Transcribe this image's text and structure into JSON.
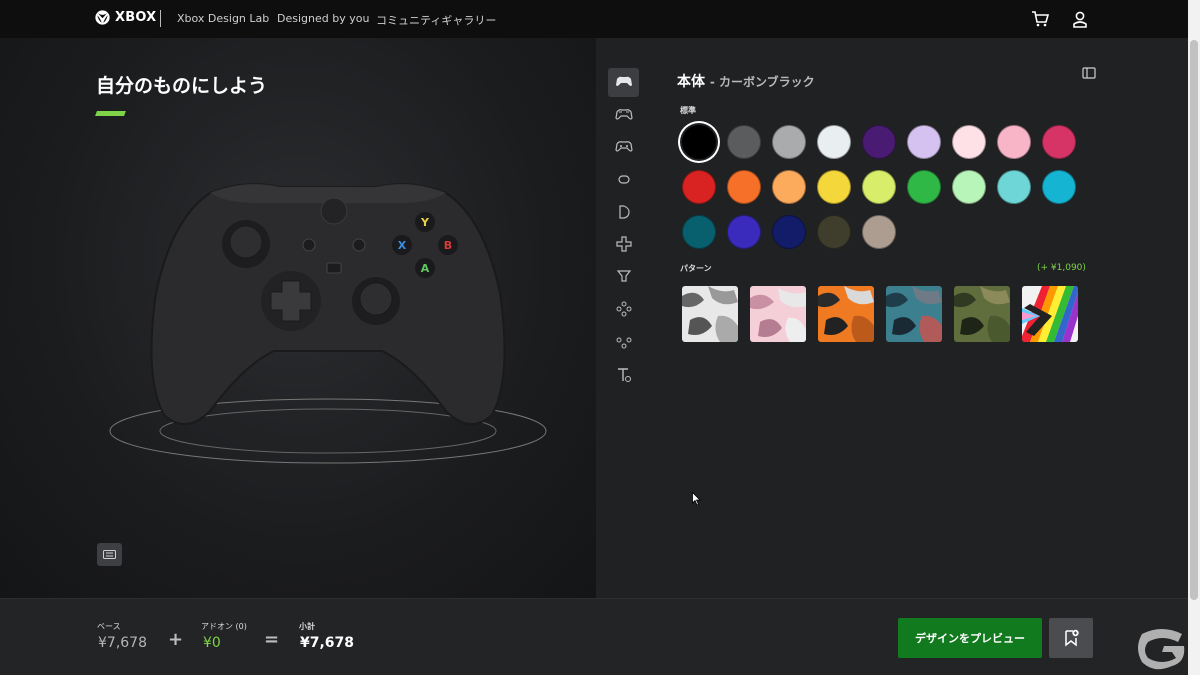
{
  "topbar": {
    "brand": "XBOX",
    "nav": [
      "Xbox Design Lab",
      "Designed by you",
      "コミュニティギャラリー"
    ],
    "icons": [
      "cart-icon",
      "account-icon"
    ]
  },
  "left": {
    "headline": "自分のものにしよう",
    "accent_color": "#7ed348"
  },
  "right": {
    "section_title": "本体",
    "section_subtitle": "- カーボンブラック",
    "solid_label": "標準",
    "pattern_label": "パターン",
    "pattern_price": "(+ ¥1,090)",
    "tabs": [
      "body-icon",
      "top-bumpers-icon",
      "back-case-icon",
      "bumpers-icon",
      "triggers-icon",
      "dpad-icon",
      "thumbsticks-icon",
      "abxy-icon",
      "view-menu-icon",
      "engraving-icon"
    ],
    "colors": [
      "#000000",
      "#5b5c5e",
      "#a9abad",
      "#e9eef1",
      "#4a1b72",
      "#d6c2f0",
      "#fde1e6",
      "#f9b5c8",
      "#d63366",
      "#d92222",
      "#f7702a",
      "#fcaa5c",
      "#f4d73b",
      "#d8ee6a",
      "#2fb845",
      "#b8f5b8",
      "#6ed6d6",
      "#14b4d2",
      "#08606e",
      "#3a2bbd",
      "#121c68",
      "#3f3e2c",
      "#ad9d90"
    ],
    "selected_color_index": 0,
    "patterns": [
      "arctic-camo",
      "pink-camo",
      "orange-camo",
      "blue-camo",
      "green-camo",
      "pride-stripes"
    ]
  },
  "bottom": {
    "base_label": "ベース",
    "base_value": "¥7,678",
    "addon_label": "アドオン (0)",
    "addon_value": "¥0",
    "plus": "+",
    "equals": "=",
    "subtotal_label": "小計",
    "subtotal_value": "¥7,678",
    "preview_button": "デザインをプレビュー"
  }
}
